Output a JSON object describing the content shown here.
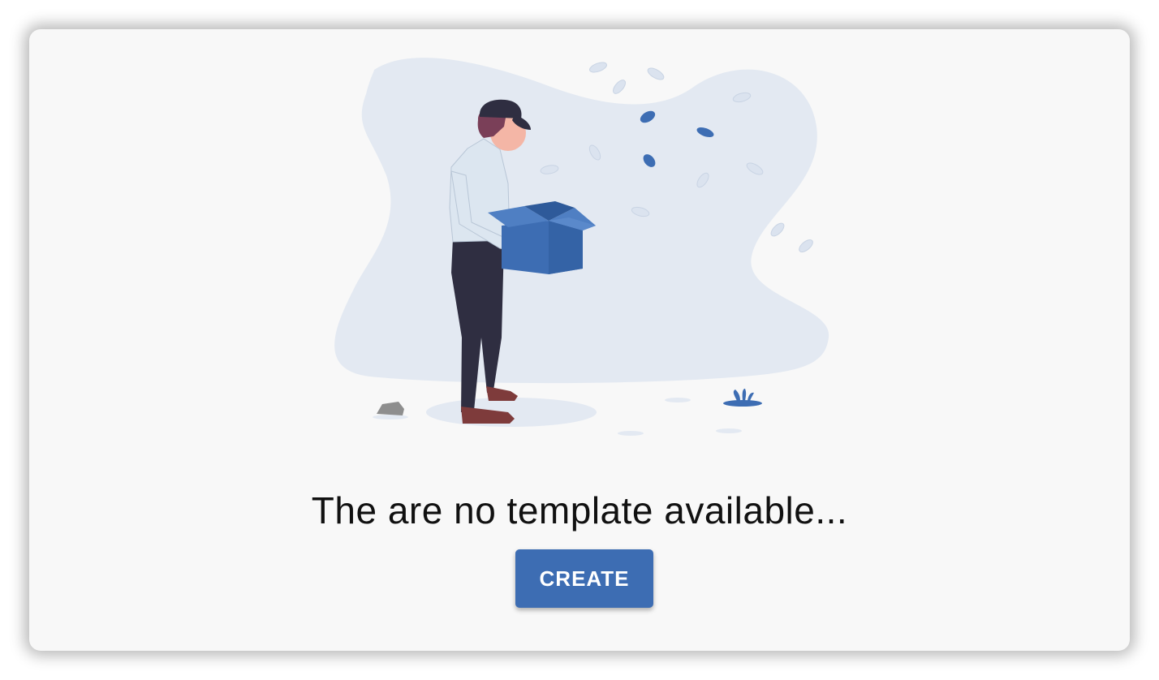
{
  "empty_state": {
    "message": "The are no template available...",
    "create_label": "CREATE",
    "illustration_icon": "person-with-empty-box-illustration"
  },
  "colors": {
    "card_background": "#f8f8f8",
    "blob": "#e3e9f2",
    "accent": "#3d6db3",
    "text": "#111111"
  }
}
